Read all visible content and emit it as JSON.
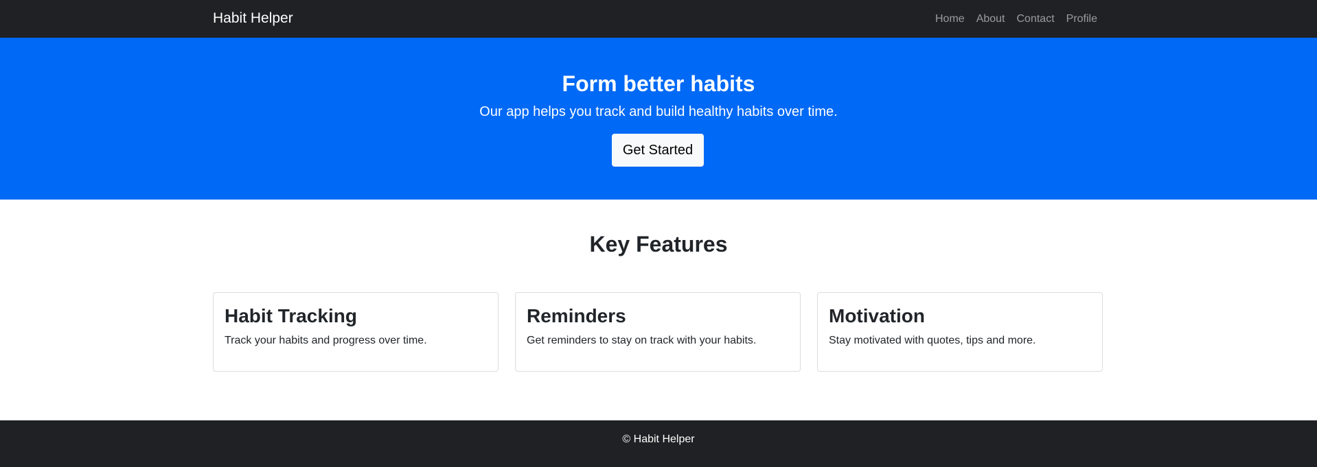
{
  "navbar": {
    "brand": "Habit Helper",
    "links": [
      "Home",
      "About",
      "Contact",
      "Profile"
    ]
  },
  "hero": {
    "title": "Form better habits",
    "subtitle": "Our app helps you track and build healthy habits over time.",
    "button_label": "Get Started"
  },
  "features": {
    "title": "Key Features",
    "cards": [
      {
        "title": "Habit Tracking",
        "text": "Track your habits and progress over time."
      },
      {
        "title": "Reminders",
        "text": "Get reminders to stay on track with your habits."
      },
      {
        "title": "Motivation",
        "text": "Stay motivated with quotes, tips and more."
      }
    ]
  },
  "footer": {
    "text": "© Habit Helper"
  },
  "colors": {
    "navbar_bg": "#1f2124",
    "hero_bg": "#0069f5",
    "button_bg": "#f8f9fa",
    "footer_bg": "#1f2124"
  }
}
